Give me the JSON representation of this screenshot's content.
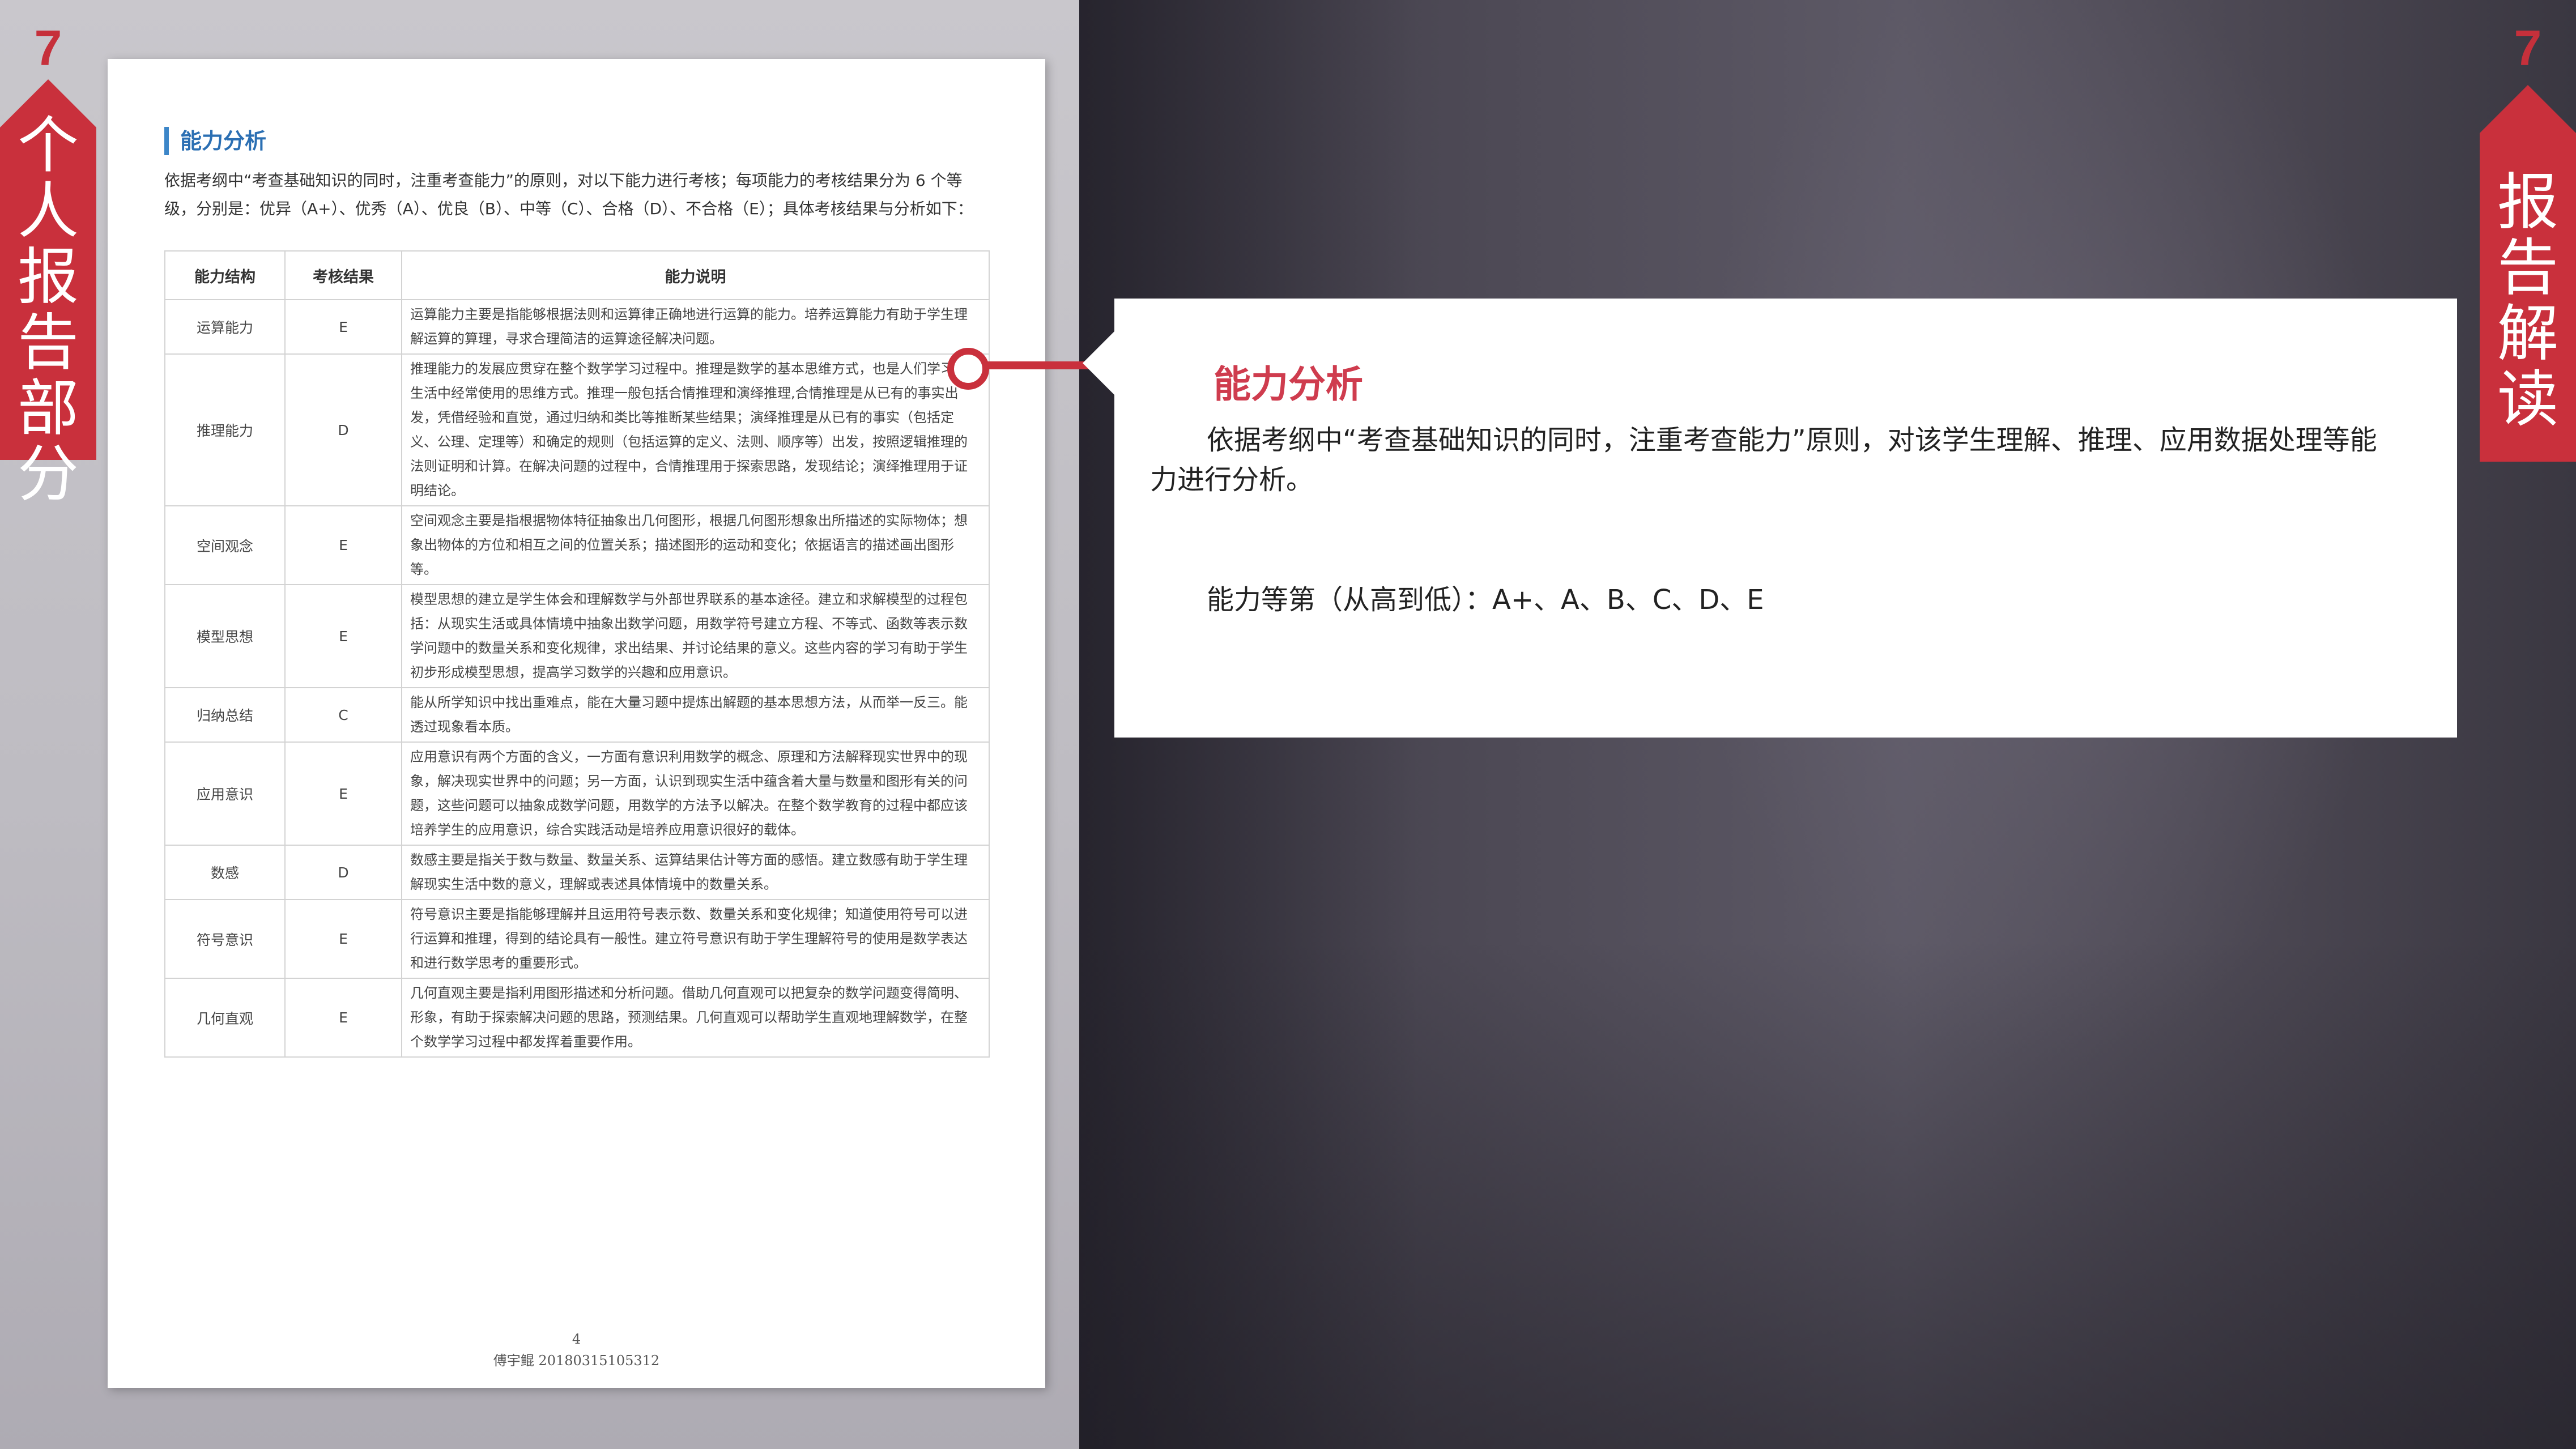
{
  "left_ribbon": {
    "number": "7",
    "label": "个人报告部分"
  },
  "right_ribbon": {
    "number": "7",
    "label": "报告解读"
  },
  "document": {
    "heading": "能力分析",
    "intro": "依据考纲中“考查基础知识的同时，注重考查能力”的原则，对以下能力进行考核；每项能力的考核结果分为 6 个等级，分别是：优异（A+）、优秀（A）、优良（B）、中等（C）、合格（D）、不合格（E）；具体考核结果与分析如下：",
    "table": {
      "headers": [
        "能力结构",
        "考核结果",
        "能力说明"
      ],
      "rows": [
        {
          "name": "运算能力",
          "result": "E",
          "desc": "运算能力主要是指能够根据法则和运算律正确地进行运算的能力。培养运算能力有助于学生理解运算的算理，寻求合理简洁的运算途径解决问题。"
        },
        {
          "name": "推理能力",
          "result": "D",
          "desc": "推理能力的发展应贯穿在整个数学学习过程中。推理是数学的基本思维方式，也是人们学习和生活中经常使用的思维方式。推理一般包括合情推理和演绎推理,合情推理是从已有的事实出发，凭借经验和直觉，通过归纳和类比等推断某些结果；演绎推理是从已有的事实（包括定义、公理、定理等）和确定的规则（包括运算的定义、法则、顺序等）出发，按照逻辑推理的法则证明和计算。在解决问题的过程中，合情推理用于探索思路，发现结论；演绎推理用于证明结论。"
        },
        {
          "name": "空间观念",
          "result": "E",
          "desc": "空间观念主要是指根据物体特征抽象出几何图形，根据几何图形想象出所描述的实际物体；想象出物体的方位和相互之间的位置关系；描述图形的运动和变化；依据语言的描述画出图形等。"
        },
        {
          "name": "模型思想",
          "result": "E",
          "desc": "模型思想的建立是学生体会和理解数学与外部世界联系的基本途径。建立和求解模型的过程包括：从现实生活或具体情境中抽象出数学问题，用数学符号建立方程、不等式、函数等表示数学问题中的数量关系和变化规律，求出结果、并讨论结果的意义。这些内容的学习有助于学生初步形成模型思想，提高学习数学的兴趣和应用意识。"
        },
        {
          "name": "归纳总结",
          "result": "C",
          "desc": "能从所学知识中找出重难点，能在大量习题中提炼出解题的基本思想方法，从而举一反三。能透过现象看本质。"
        },
        {
          "name": "应用意识",
          "result": "E",
          "desc": "应用意识有两个方面的含义，一方面有意识利用数学的概念、原理和方法解释现实世界中的现象，解决现实世界中的问题；另一方面，认识到现实生活中蕴含着大量与数量和图形有关的问题，这些问题可以抽象成数学问题，用数学的方法予以解决。在整个数学教育的过程中都应该培养学生的应用意识，综合实践活动是培养应用意识很好的载体。"
        },
        {
          "name": "数感",
          "result": "D",
          "desc": "数感主要是指关于数与数量、数量关系、运算结果估计等方面的感悟。建立数感有助于学生理解现实生活中数的意义，理解或表述具体情境中的数量关系。"
        },
        {
          "name": "符号意识",
          "result": "E",
          "desc": "符号意识主要是指能够理解并且运用符号表示数、数量关系和变化规律；知道使用符号可以进行运算和推理，得到的结论具有一般性。建立符号意识有助于学生理解符号的使用是数学表达和进行数学思考的重要形式。"
        },
        {
          "name": "几何直观",
          "result": "E",
          "desc": "几何直观主要是指利用图形描述和分析问题。借助几何直观可以把复杂的数学问题变得简明、形象，有助于探索解决问题的思路，预测结果。几何直观可以帮助学生直观地理解数学，在整个数学学习过程中都发挥着重要作用。"
        }
      ]
    },
    "page_number": "4",
    "footer": "傅宇鲲  20180315105312"
  },
  "panel": {
    "title": "能力分析",
    "body": "依据考纲中“考查基础知识的同时，注重考查能力”原则，对该学生理解、推理、应用数据处理等能力进行分析。",
    "levels": "能力等第（从高到低）：A+、A、B、C、D、E"
  },
  "colors": {
    "accent_red": "#c9303c",
    "title_red": "#cf3c4e",
    "doc_blue": "#2b6fb3"
  }
}
